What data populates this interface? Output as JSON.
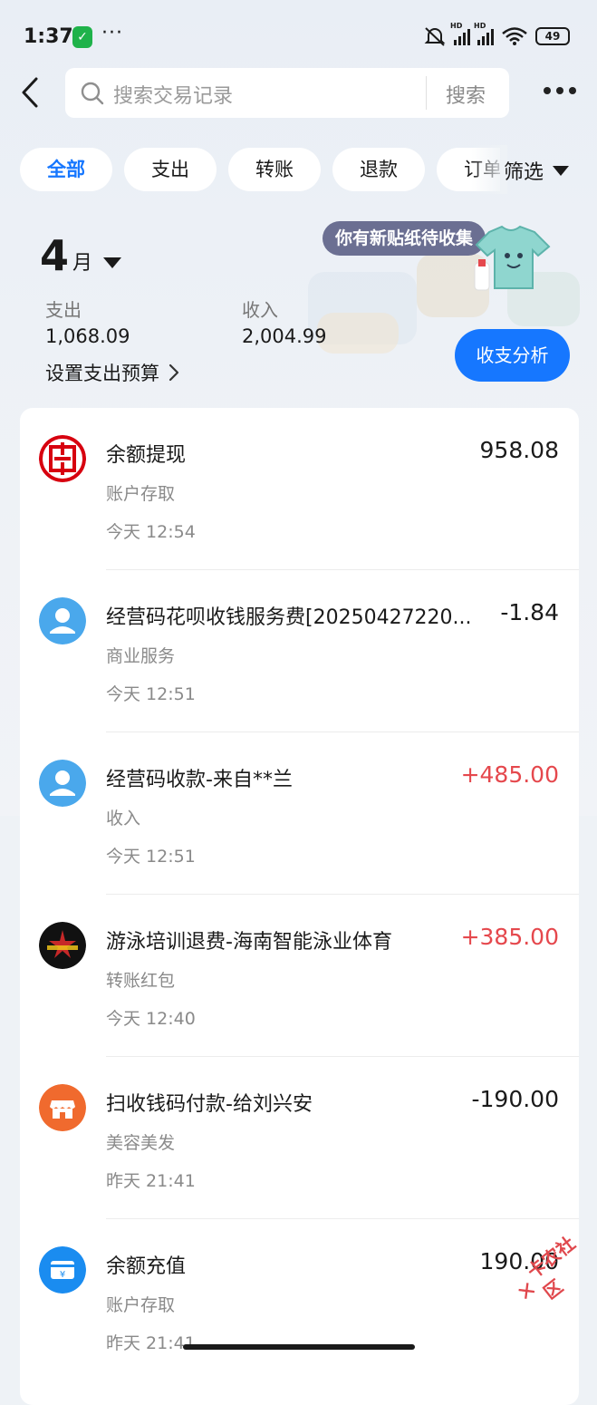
{
  "status_bar": {
    "time": "1:37",
    "more": "···",
    "battery": "49"
  },
  "search": {
    "placeholder": "搜索交易记录",
    "button": "搜索"
  },
  "tabs": [
    {
      "label": "全部",
      "active": true
    },
    {
      "label": "支出",
      "active": false
    },
    {
      "label": "转账",
      "active": false
    },
    {
      "label": "退款",
      "active": false
    },
    {
      "label": "订单",
      "active": false
    }
  ],
  "filter_label": "筛选",
  "summary": {
    "month_num": "4",
    "month_unit": "月",
    "sticker": "你有新贴纸待收集",
    "expense_label": "支出",
    "expense_value": "1,068.09",
    "income_label": "收入",
    "income_value": "2,004.99",
    "budget_label": "设置支出预算",
    "analysis_button": "收支分析"
  },
  "transactions": [
    {
      "icon": "icbc-logo-icon",
      "title": "余额提现",
      "category": "账户存取",
      "time": "今天 12:54",
      "amount": "958.08",
      "sign": "neutral"
    },
    {
      "icon": "user-avatar-icon",
      "title": "经营码花呗收钱服务费[20250427220...",
      "category": "商业服务",
      "time": "今天 12:51",
      "amount": "-1.84",
      "sign": "neg"
    },
    {
      "icon": "user-avatar-icon",
      "title": "经营码收款-来自**兰",
      "category": "收入",
      "time": "今天 12:51",
      "amount": "+485.00",
      "sign": "pos"
    },
    {
      "icon": "swim-logo-icon",
      "title": "游泳培训退费-海南智能泳业体育",
      "category": "转账红包",
      "time": "今天 12:40",
      "amount": "+385.00",
      "sign": "pos"
    },
    {
      "icon": "shop-icon",
      "title": "扫收钱码付款-给刘兴安",
      "category": "美容美发",
      "time": "昨天 21:41",
      "amount": "-190.00",
      "sign": "neg"
    },
    {
      "icon": "recharge-card-icon",
      "title": "余额充值",
      "category": "账户存取",
      "time": "昨天 21:41",
      "amount": "190.00",
      "sign": "neutral"
    }
  ],
  "watermark": "卡农社区",
  "colors": {
    "accent": "#1677ff",
    "positive_amount": "#e5484d",
    "icbc_red": "#d7000f",
    "avatar_blue": "#4aa8ec",
    "shop_orange": "#f06a2e",
    "recharge_blue": "#1a8cf0"
  }
}
